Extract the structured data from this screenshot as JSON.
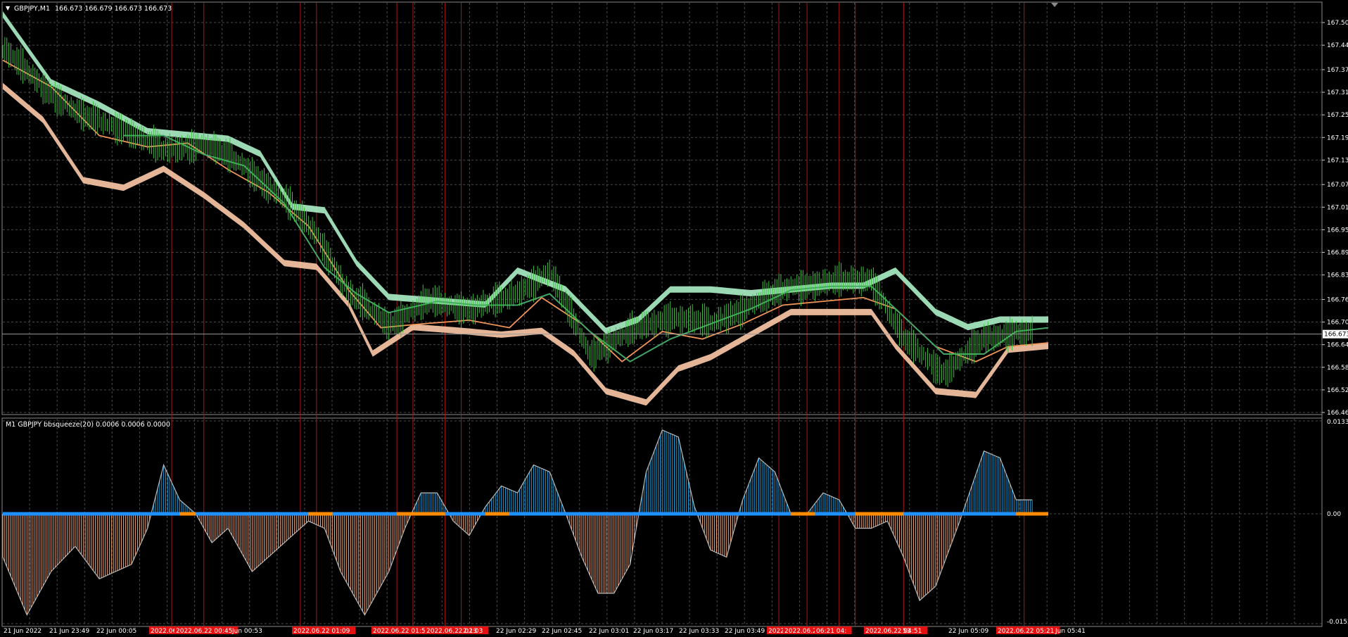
{
  "main_window": {
    "title": "GBPJPY,M1",
    "ohlc": "166.673 166.679 166.673 166.673"
  },
  "price_axis": {
    "ticks": [
      "167.500",
      "167.440",
      "167.375",
      "167.315",
      "167.255",
      "167.195",
      "167.135",
      "167.070",
      "167.010",
      "166.950",
      "166.890",
      "166.830",
      "166.765",
      "166.705",
      "166.645",
      "166.585",
      "166.525",
      "166.465"
    ],
    "current_price": "166.673"
  },
  "indicator": {
    "title": "M1 GBPJPY bbsqueeze(20) 0.0006 0.0006 0.0000",
    "ticks": [
      "0.0133",
      "0.00",
      "-0.0152"
    ]
  },
  "time_axis": {
    "labels": [
      "21 Jun 2022",
      "21 Jun 23:49",
      "22 Jun 00:05",
      "2022.06.",
      "2022.06.22 00:45",
      "Jun 00:53",
      "2022.06.22 01:09",
      "2022.06.22 01:51",
      "2022.06.22 02:03",
      "2:13",
      "22 Jun 02:29",
      "22 Jun 02:45",
      "22 Jun 03:01",
      "22 Jun 03:17",
      "22 Jun 03:33",
      "22 Jun 03:49",
      "2022.0",
      "2022.06.22",
      "06:21 04:",
      "2022.06.22 04:51",
      "53",
      "22 Jun 05:09",
      "2022.06.22 05:21",
      "Jun 05:41"
    ]
  },
  "colors": {
    "background": "#000000",
    "grid": "#4a4a4a",
    "candle": "#3fbf3f",
    "upper_band": "#a8ecc4",
    "lower_band": "#f7c4a4",
    "middle_ma": "#f0955a",
    "signal_ma": "#43a467",
    "histogram_positive": "#1a9fe0",
    "histogram_negative": "#f4a77c",
    "squeeze_on": "#ff8c00",
    "squeeze_off": "#1e90ff",
    "event_line": "#b0160c",
    "event_label": "#e51010"
  },
  "chart_data": [
    {
      "type": "line",
      "title": "GBPJPY,M1",
      "ylim": [
        166.465,
        167.53
      ],
      "x_index_range": [
        0,
        260
      ],
      "series": [
        {
          "key": "close",
          "points": [
            [
              0,
              167.43
            ],
            [
              10,
              167.33
            ],
            [
              20,
              167.25
            ],
            [
              30,
              167.22
            ],
            [
              40,
              167.16
            ],
            [
              50,
              167.18
            ],
            [
              60,
              167.12
            ],
            [
              70,
              167.03
            ],
            [
              78,
              166.94
            ],
            [
              86,
              166.78
            ],
            [
              96,
              166.7
            ],
            [
              106,
              166.76
            ],
            [
              116,
              166.74
            ],
            [
              126,
              166.77
            ],
            [
              136,
              166.84
            ],
            [
              146,
              166.62
            ],
            [
              156,
              166.68
            ],
            [
              166,
              166.72
            ],
            [
              176,
              166.7
            ],
            [
              186,
              166.75
            ],
            [
              196,
              166.8
            ],
            [
              206,
              166.81
            ],
            [
              216,
              166.82
            ],
            [
              224,
              166.66
            ],
            [
              234,
              166.57
            ],
            [
              244,
              166.66
            ],
            [
              252,
              166.68
            ],
            [
              260,
              166.673
            ]
          ]
        },
        {
          "key": "upper",
          "points": [
            [
              0,
              167.53
            ],
            [
              12,
              167.35
            ],
            [
              24,
              167.29
            ],
            [
              36,
              167.22
            ],
            [
              46,
              167.21
            ],
            [
              56,
              167.2
            ],
            [
              64,
              167.16
            ],
            [
              72,
              167.02
            ],
            [
              80,
              167.01
            ],
            [
              88,
              166.87
            ],
            [
              96,
              166.78
            ],
            [
              108,
              166.77
            ],
            [
              120,
              166.76
            ],
            [
              128,
              166.85
            ],
            [
              140,
              166.8
            ],
            [
              150,
              166.69
            ],
            [
              158,
              166.72
            ],
            [
              166,
              166.8
            ],
            [
              176,
              166.8
            ],
            [
              186,
              166.79
            ],
            [
              196,
              166.8
            ],
            [
              206,
              166.81
            ],
            [
              214,
              166.81
            ],
            [
              222,
              166.85
            ],
            [
              232,
              166.74
            ],
            [
              240,
              166.7
            ],
            [
              248,
              166.72
            ],
            [
              260,
              166.72
            ]
          ]
        },
        {
          "key": "lower",
          "points": [
            [
              0,
              167.34
            ],
            [
              10,
              167.25
            ],
            [
              20,
              167.09
            ],
            [
              30,
              167.07
            ],
            [
              40,
              167.12
            ],
            [
              50,
              167.05
            ],
            [
              60,
              166.97
            ],
            [
              70,
              166.87
            ],
            [
              78,
              166.86
            ],
            [
              86,
              166.76
            ],
            [
              92,
              166.63
            ],
            [
              102,
              166.7
            ],
            [
              114,
              166.69
            ],
            [
              124,
              166.68
            ],
            [
              134,
              166.69
            ],
            [
              142,
              166.63
            ],
            [
              150,
              166.53
            ],
            [
              160,
              166.5
            ],
            [
              168,
              166.59
            ],
            [
              176,
              166.62
            ],
            [
              186,
              166.68
            ],
            [
              196,
              166.74
            ],
            [
              206,
              166.74
            ],
            [
              216,
              166.74
            ],
            [
              222,
              166.65
            ],
            [
              232,
              166.53
            ],
            [
              242,
              166.52
            ],
            [
              250,
              166.64
            ],
            [
              260,
              166.65
            ]
          ]
        },
        {
          "key": "ma_mid",
          "points": [
            [
              0,
              167.4
            ],
            [
              12,
              167.33
            ],
            [
              24,
              167.2
            ],
            [
              36,
              167.17
            ],
            [
              46,
              167.18
            ],
            [
              56,
              167.11
            ],
            [
              66,
              167.05
            ],
            [
              76,
              166.96
            ],
            [
              86,
              166.79
            ],
            [
              94,
              166.69
            ],
            [
              104,
              166.7
            ],
            [
              116,
              166.71
            ],
            [
              126,
              166.69
            ],
            [
              134,
              166.77
            ],
            [
              144,
              166.7
            ],
            [
              154,
              166.6
            ],
            [
              164,
              166.68
            ],
            [
              174,
              166.66
            ],
            [
              184,
              166.7
            ],
            [
              194,
              166.75
            ],
            [
              204,
              166.76
            ],
            [
              214,
              166.77
            ],
            [
              222,
              166.74
            ],
            [
              232,
              166.64
            ],
            [
              242,
              166.6
            ],
            [
              250,
              166.64
            ],
            [
              260,
              166.65
            ]
          ]
        },
        {
          "key": "ma_signal",
          "points": [
            [
              30,
              167.2
            ],
            [
              40,
              167.2
            ],
            [
              50,
              167.15
            ],
            [
              60,
              167.12
            ],
            [
              70,
              167.02
            ],
            [
              80,
              166.85
            ],
            [
              88,
              166.78
            ],
            [
              96,
              166.73
            ],
            [
              108,
              166.76
            ],
            [
              118,
              166.75
            ],
            [
              128,
              166.75
            ],
            [
              136,
              166.78
            ],
            [
              146,
              166.68
            ],
            [
              156,
              166.6
            ],
            [
              166,
              166.66
            ],
            [
              176,
              166.7
            ],
            [
              186,
              166.74
            ],
            [
              196,
              166.79
            ],
            [
              206,
              166.8
            ],
            [
              216,
              166.8
            ],
            [
              224,
              166.72
            ],
            [
              234,
              166.62
            ],
            [
              244,
              166.62
            ],
            [
              252,
              166.68
            ],
            [
              260,
              166.69
            ]
          ]
        }
      ],
      "event_x": [
        42,
        50,
        74,
        78,
        98,
        102,
        110,
        114,
        193,
        200,
        208,
        212,
        224,
        254
      ]
    },
    {
      "type": "bar",
      "title": "M1 GBPJPY bbsqueeze(20) 0.0006 0.0006 0.0000",
      "ylim": [
        -0.0152,
        0.0133
      ],
      "x_index_range": [
        0,
        260
      ],
      "histogram": [
        [
          0,
          -0.006
        ],
        [
          6,
          -0.014
        ],
        [
          12,
          -0.008
        ],
        [
          18,
          -0.0045
        ],
        [
          24,
          -0.009
        ],
        [
          32,
          -0.007
        ],
        [
          36,
          -0.002
        ],
        [
          40,
          0.007
        ],
        [
          44,
          0.002
        ],
        [
          48,
          0.0
        ],
        [
          52,
          -0.004
        ],
        [
          56,
          -0.002
        ],
        [
          62,
          -0.008
        ],
        [
          66,
          -0.006
        ],
        [
          72,
          -0.003
        ],
        [
          76,
          -0.001
        ],
        [
          80,
          -0.002
        ],
        [
          84,
          -0.008
        ],
        [
          90,
          -0.014
        ],
        [
          96,
          -0.008
        ],
        [
          100,
          -0.002
        ],
        [
          104,
          0.003
        ],
        [
          108,
          0.003
        ],
        [
          112,
          -0.001
        ],
        [
          116,
          -0.003
        ],
        [
          120,
          0.001
        ],
        [
          124,
          0.004
        ],
        [
          128,
          0.003
        ],
        [
          132,
          0.007
        ],
        [
          136,
          0.006
        ],
        [
          140,
          0.0
        ],
        [
          144,
          -0.006
        ],
        [
          148,
          -0.011
        ],
        [
          152,
          -0.011
        ],
        [
          156,
          -0.007
        ],
        [
          160,
          0.006
        ],
        [
          164,
          0.012
        ],
        [
          168,
          0.011
        ],
        [
          172,
          0.001
        ],
        [
          176,
          -0.005
        ],
        [
          180,
          -0.006
        ],
        [
          184,
          0.002
        ],
        [
          188,
          0.008
        ],
        [
          192,
          0.006
        ],
        [
          196,
          0.0
        ],
        [
          200,
          0.0
        ],
        [
          204,
          0.003
        ],
        [
          208,
          0.002
        ],
        [
          212,
          -0.002
        ],
        [
          216,
          -0.002
        ],
        [
          220,
          -0.001
        ],
        [
          224,
          -0.006
        ],
        [
          228,
          -0.012
        ],
        [
          232,
          -0.01
        ],
        [
          238,
          -0.001
        ],
        [
          244,
          0.009
        ],
        [
          248,
          0.008
        ],
        [
          252,
          0.002
        ],
        [
          256,
          0.002
        ],
        [
          260,
          0.001
        ]
      ],
      "squeeze_on_x": [
        [
          44,
          48
        ],
        [
          76,
          82
        ],
        [
          98,
          110
        ],
        [
          120,
          126
        ],
        [
          196,
          202
        ],
        [
          212,
          224
        ],
        [
          252,
          260
        ]
      ]
    }
  ]
}
